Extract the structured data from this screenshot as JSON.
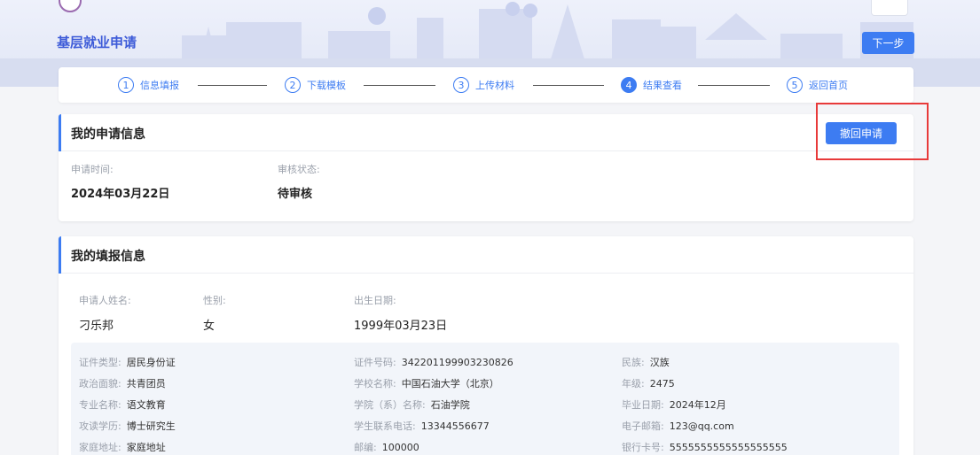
{
  "header": {
    "app_title": "基层就业申请",
    "next_button": "下一步"
  },
  "steps": [
    {
      "num": "1",
      "label": "信息填报",
      "active": false
    },
    {
      "num": "2",
      "label": "下载模板",
      "active": false
    },
    {
      "num": "3",
      "label": "上传材料",
      "active": false
    },
    {
      "num": "4",
      "label": "结果查看",
      "active": true
    },
    {
      "num": "5",
      "label": "返回首页",
      "active": false
    }
  ],
  "application": {
    "title": "我的申请信息",
    "withdraw_button": "撤回申请",
    "time_label": "申请时间:",
    "time_value": "2024年03月22日",
    "status_label": "审核状态:",
    "status_value": "待审核"
  },
  "form": {
    "title": "我的填报信息",
    "name_label": "申请人姓名:",
    "name_value": "刁乐邦",
    "gender_label": "性别:",
    "gender_value": "女",
    "birth_label": "出生日期:",
    "birth_value": "1999年03月23日",
    "details": [
      {
        "k": "证件类型:",
        "v": "居民身份证"
      },
      {
        "k": "证件号码:",
        "v": "342201199903230826"
      },
      {
        "k": "民族:",
        "v": "汉族"
      },
      {
        "k": "政治面貌:",
        "v": "共青团员"
      },
      {
        "k": "学校名称:",
        "v": "中国石油大学（北京）"
      },
      {
        "k": "年级:",
        "v": "2475"
      },
      {
        "k": "专业名称:",
        "v": "语文教育"
      },
      {
        "k": "学院（系）名称:",
        "v": "石油学院"
      },
      {
        "k": "毕业日期:",
        "v": "2024年12月"
      },
      {
        "k": "攻读学历:",
        "v": "博士研究生"
      },
      {
        "k": "学生联系电话:",
        "v": "13344556677"
      },
      {
        "k": "电子邮箱:",
        "v": "123@qq.com"
      },
      {
        "k": "家庭地址:",
        "v": "家庭地址"
      },
      {
        "k": "邮编:",
        "v": "100000"
      },
      {
        "k": "银行卡号:",
        "v": "5555555555555555555"
      }
    ]
  },
  "colors": {
    "accent": "#3d7cf2",
    "highlight": "#e83a3a"
  }
}
